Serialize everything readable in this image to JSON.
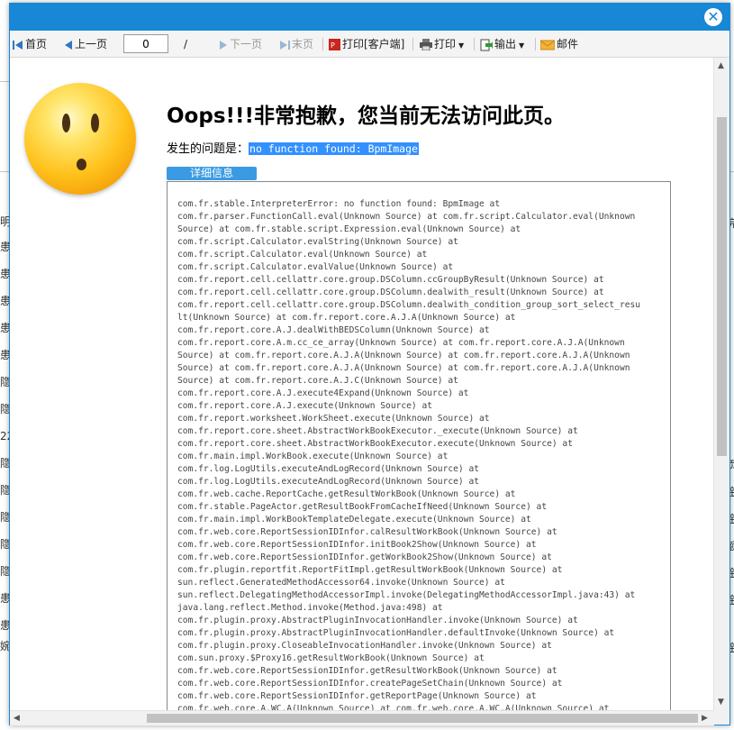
{
  "toolbar": {
    "first": "首页",
    "prev": "上一页",
    "page_value": "0",
    "page_sep": "/",
    "next": "下一页",
    "last": "末页",
    "print_client": "打印[客户端]",
    "print": "打印",
    "export": "输出",
    "mail": "邮件"
  },
  "error": {
    "title": "Oops!!!非常抱歉，您当前无法访问此页。",
    "problem_label": "发生的问题是：",
    "problem_message": "no function found: BpmImage",
    "detail_button": "详细信息",
    "stacktrace": "com.fr.stable.InterpreterError: no function found: BpmImage at\ncom.fr.parser.FunctionCall.eval(Unknown Source) at com.fr.script.Calculator.eval(Unknown\nSource) at com.fr.stable.script.Expression.eval(Unknown Source) at\ncom.fr.script.Calculator.evalString(Unknown Source) at\ncom.fr.script.Calculator.eval(Unknown Source) at\ncom.fr.script.Calculator.evalValue(Unknown Source) at\ncom.fr.report.cell.cellattr.core.group.DSColumn.ccGroupByResult(Unknown Source) at\ncom.fr.report.cell.cellattr.core.group.DSColumn.dealwith_result(Unknown Source) at\ncom.fr.report.cell.cellattr.core.group.DSColumn.dealwith_condition_group_sort_select_resu\nlt(Unknown Source) at com.fr.report.core.A.J.A(Unknown Source) at\ncom.fr.report.core.A.J.dealWithBEDSColumn(Unknown Source) at\ncom.fr.report.core.A.m.cc_ce_array(Unknown Source) at com.fr.report.core.A.J.A(Unknown\nSource) at com.fr.report.core.A.J.A(Unknown Source) at com.fr.report.core.A.J.A(Unknown\nSource) at com.fr.report.core.A.J.A(Unknown Source) at com.fr.report.core.A.J.A(Unknown\nSource) at com.fr.report.core.A.J.C(Unknown Source) at\ncom.fr.report.core.A.J.execute4Expand(Unknown Source) at\ncom.fr.report.core.A.J.execute(Unknown Source) at\ncom.fr.report.worksheet.WorkSheet.execute(Unknown Source) at\ncom.fr.report.core.sheet.AbstractWorkBookExecutor._execute(Unknown Source) at\ncom.fr.report.core.sheet.AbstractWorkBookExecutor.execute(Unknown Source) at\ncom.fr.main.impl.WorkBook.execute(Unknown Source) at\ncom.fr.log.LogUtils.executeAndLogRecord(Unknown Source) at\ncom.fr.log.LogUtils.executeAndLogRecord(Unknown Source) at\ncom.fr.web.cache.ReportCache.getResultWorkBook(Unknown Source) at\ncom.fr.stable.PageActor.getResultBookFromCacheIfNeed(Unknown Source) at\ncom.fr.main.impl.WorkBookTemplateDelegate.execute(Unknown Source) at\ncom.fr.web.core.ReportSessionIDInfor.calResultWorkBook(Unknown Source) at\ncom.fr.web.core.ReportSessionIDInfor.initBook2Show(Unknown Source) at\ncom.fr.web.core.ReportSessionIDInfor.getWorkBook2Show(Unknown Source) at\ncom.fr.plugin.reportfit.ReportFitImpl.getResultWorkBook(Unknown Source) at\nsun.reflect.GeneratedMethodAccessor64.invoke(Unknown Source) at\nsun.reflect.DelegatingMethodAccessorImpl.invoke(DelegatingMethodAccessorImpl.java:43) at\njava.lang.reflect.Method.invoke(Method.java:498) at\ncom.fr.plugin.proxy.AbstractPluginInvocationHandler.invoke(Unknown Source) at\ncom.fr.plugin.proxy.AbstractPluginInvocationHandler.defaultInvoke(Unknown Source) at\ncom.fr.plugin.proxy.CloseableInvocationHandler.invoke(Unknown Source) at\ncom.sun.proxy.$Proxy16.getResultWorkBook(Unknown Source) at\ncom.fr.web.core.ReportSessionIDInfor.getResultWorkBook(Unknown Source) at\ncom.fr.web.core.ReportSessionIDInfor.createPageSetChain(Unknown Source) at\ncom.fr.web.core.ReportSessionIDInfor.getReportPage(Unknown Source) at\ncom.fr.web.core.A.WC.A(Unknown Source) at com.fr.web.core.A.WC.A(Unknown Source) at"
  },
  "background": {
    "left_chars": [
      "明",
      "患",
      "患",
      "患",
      "患",
      "患",
      "隐",
      "隐",
      "22",
      "隐",
      "隐",
      "隐",
      "隐",
      "隐",
      "患",
      "患",
      "婉"
    ],
    "right_chars": [
      "完",
      "",
      "",
      "",
      "",
      "",
      "",
      "",
      "",
      "页",
      "金",
      "金",
      "额",
      "金",
      "金",
      "",
      "金"
    ]
  },
  "colors": {
    "title_bar": "#1787d6",
    "detail_button": "#3a9be2",
    "selection": "#3390ff"
  }
}
